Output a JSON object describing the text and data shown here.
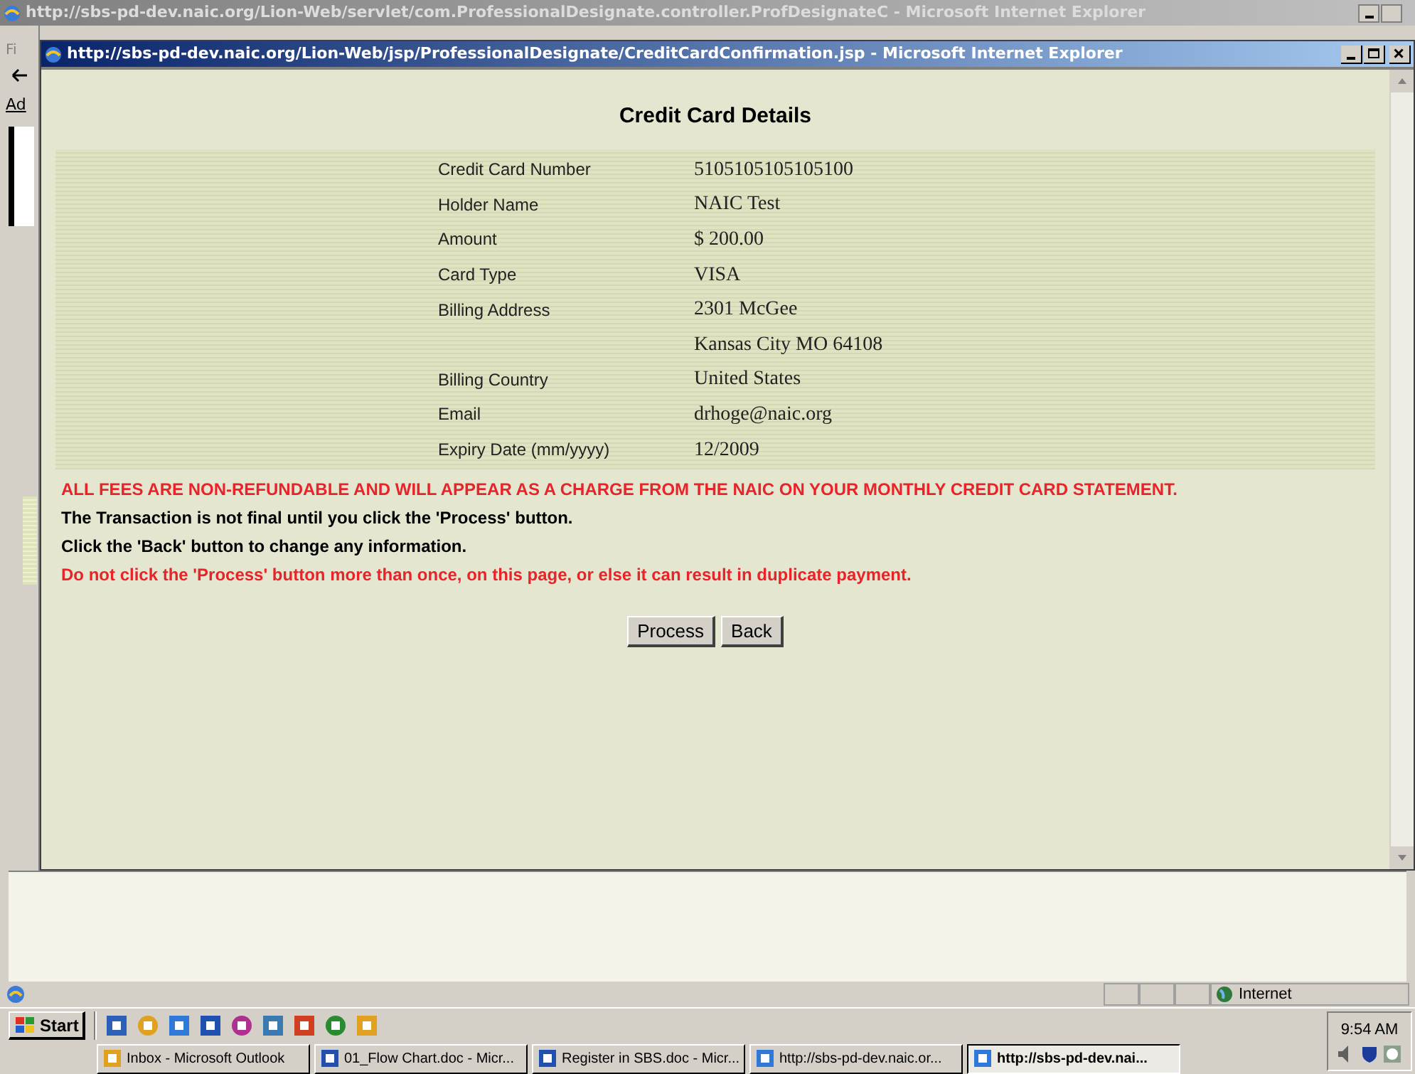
{
  "back_window": {
    "title": "http://sbs-pd-dev.naic.org/Lion-Web/servlet/com.ProfessionalDesignate.controller.ProfDesignateC - Microsoft Internet Explorer",
    "menu_fragment": "Fi",
    "address_fragment": "Ad",
    "status_bar": {
      "zone": "Internet"
    }
  },
  "window": {
    "title": "http://sbs-pd-dev.naic.org/Lion-Web/jsp/ProfessionalDesignate/CreditCardConfirmation.jsp - Microsoft Internet Explorer"
  },
  "page": {
    "heading": "Credit Card Details",
    "details": [
      {
        "label": "Credit Card Number",
        "value": "5105105105105100"
      },
      {
        "label": "Holder Name",
        "value": "NAIC Test"
      },
      {
        "label": "Amount",
        "value": "$ 200.00"
      },
      {
        "label": "Card Type",
        "value": "VISA"
      },
      {
        "label": "Billing Address",
        "value": "2301 McGee"
      },
      {
        "value": "Kansas City MO 64108"
      },
      {
        "label": "Billing Country",
        "value": "United States"
      },
      {
        "label": "Email",
        "value": "drhoge@naic.org"
      },
      {
        "label": "Expiry Date (mm/yyyy)",
        "value": "12/2009"
      }
    ],
    "notices": [
      {
        "text": "ALL FEES ARE NON-REFUNDABLE AND WILL APPEAR AS A CHARGE FROM THE NAIC ON YOUR MONTHLY CREDIT CARD STATEMENT.",
        "kind": "warning"
      },
      {
        "text": "The Transaction is not final until you click the 'Process' button.",
        "kind": "info"
      },
      {
        "text": "Click the 'Back' button to change any information.",
        "kind": "info"
      },
      {
        "text": "Do not click the 'Process' button more than once, on this page, or else it can result in duplicate payment.",
        "kind": "warning"
      }
    ],
    "buttons": [
      "Process",
      "Back"
    ]
  },
  "taskbar": {
    "start": "Start",
    "tasks": [
      {
        "label": "Inbox - Microsoft Outlook",
        "selected": false
      },
      {
        "label": "01_Flow Chart.doc - Micr...",
        "selected": false
      },
      {
        "label": "Register in SBS.doc - Micr...",
        "selected": false
      },
      {
        "label": "http://sbs-pd-dev.naic.or...",
        "selected": false
      },
      {
        "label": "http://sbs-pd-dev.nai...",
        "selected": true
      }
    ],
    "clock": "9:54 AM"
  }
}
